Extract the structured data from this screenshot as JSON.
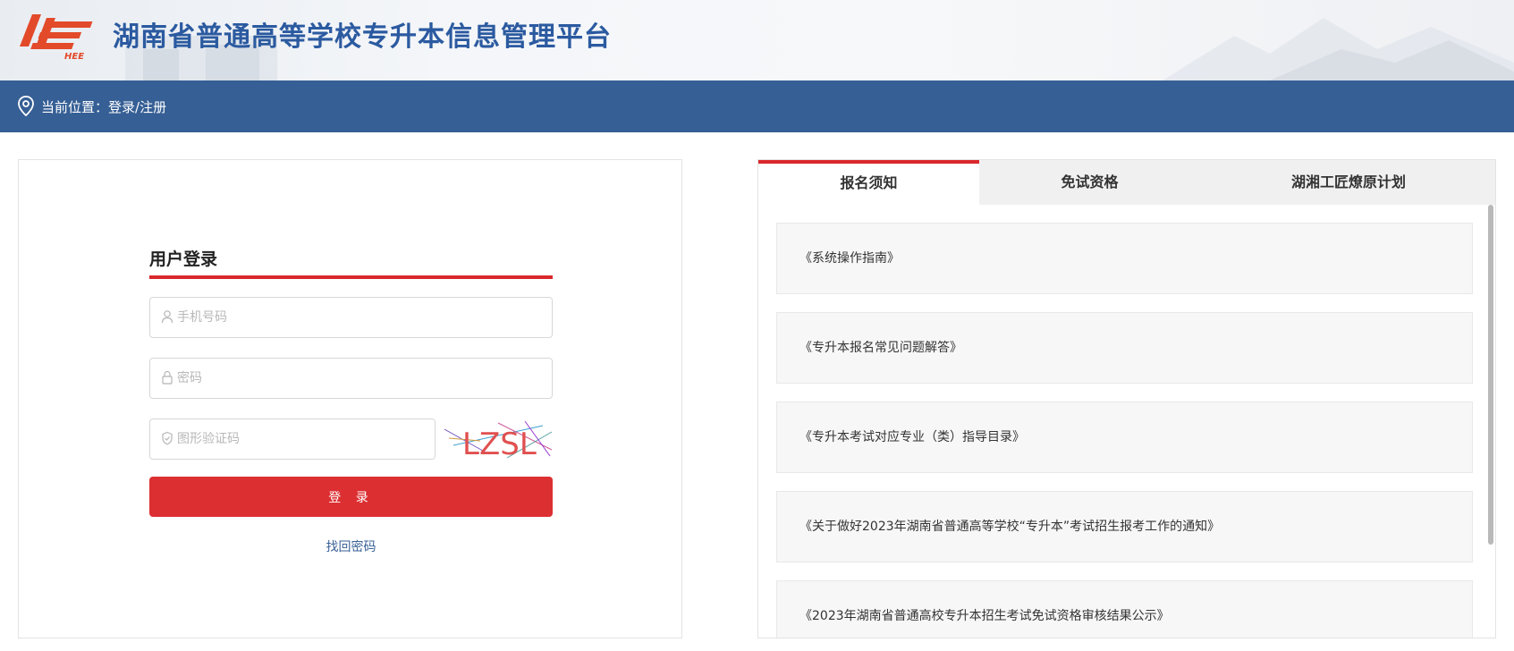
{
  "header": {
    "logo_text": "HEE",
    "title": "湖南省普通高等学校专升本信息管理平台"
  },
  "breadcrumb": {
    "prefix": "当前位置：",
    "current": "登录/注册"
  },
  "login": {
    "title": "用户登录",
    "phone_placeholder": "手机号码",
    "password_placeholder": "密码",
    "captcha_placeholder": "图形验证码",
    "captcha_text": "LZSL",
    "login_button": "登 录",
    "forgot_link": "找回密码"
  },
  "notices": {
    "tabs": [
      {
        "label": "报名须知",
        "active": true
      },
      {
        "label": "免试资格",
        "active": false
      },
      {
        "label": "湖湘工匠燎原计划",
        "active": false
      }
    ],
    "items": [
      {
        "label": "《系统操作指南》"
      },
      {
        "label": "《专升本报名常见问题解答》"
      },
      {
        "label": "《专升本考试对应专业（类）指导目录》"
      },
      {
        "label": "《关于做好2023年湖南省普通高等学校“专升本”考试招生报考工作的通知》"
      },
      {
        "label": "《2023年湖南省普通高校专升本招生考试免试资格审核结果公示》"
      }
    ]
  },
  "colors": {
    "brand_blue": "#365f95",
    "title_blue": "#2b5aa0",
    "accent_red": "#dc2f32",
    "link_blue": "#3a6297"
  }
}
